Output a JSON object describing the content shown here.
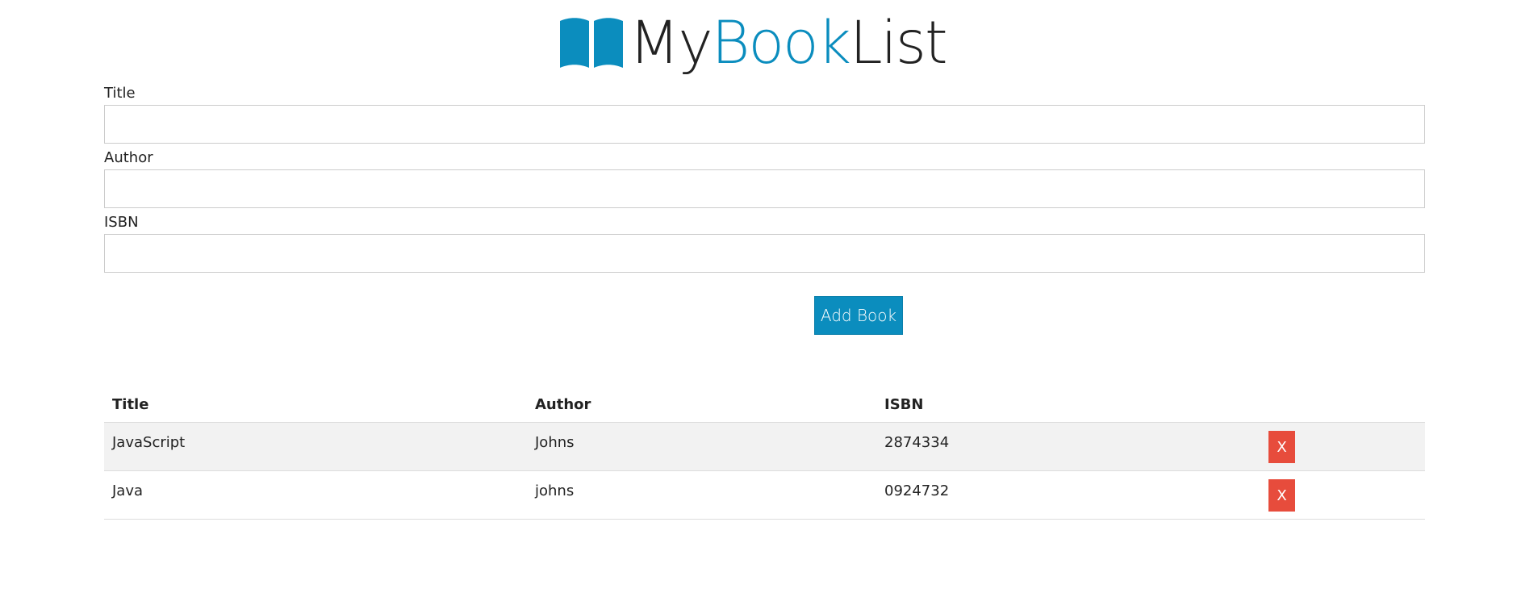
{
  "brand": {
    "icon": "open-book-icon",
    "part_my": "My",
    "part_book": "Book",
    "part_list": "List",
    "accent_color": "#0b8dbe"
  },
  "form": {
    "title_label": "Title",
    "title_value": "",
    "author_label": "Author",
    "author_value": "",
    "isbn_label": "ISBN",
    "isbn_value": "",
    "submit_label": "Add Book"
  },
  "table": {
    "headers": {
      "title": "Title",
      "author": "Author",
      "isbn": "ISBN"
    },
    "rows": [
      {
        "title": "JavaScript",
        "author": "Johns",
        "isbn": "2874334",
        "delete_label": "X"
      },
      {
        "title": "Java",
        "author": "johns",
        "isbn": "0924732",
        "delete_label": "X"
      }
    ],
    "delete_color": "#e74c3c"
  }
}
